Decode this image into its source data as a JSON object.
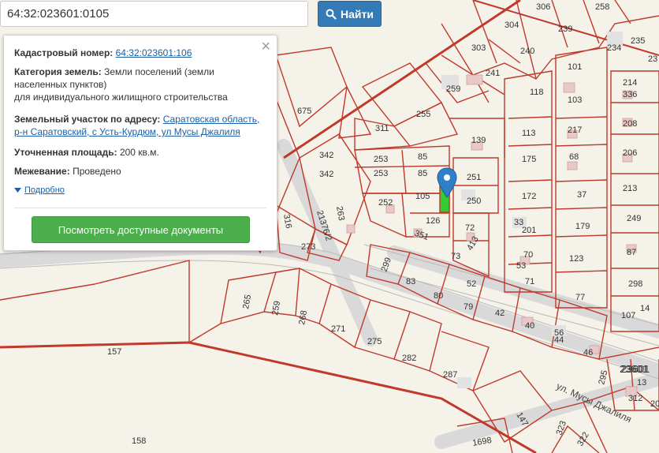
{
  "search": {
    "value": "64:32:023601:0105",
    "button_label": "Найти",
    "icon": "search-icon"
  },
  "info_panel": {
    "cadastral_label": "Кадастровый номер:",
    "cadastral_number": "64:32:023601:106",
    "category_label": "Категория земель:",
    "category_value_1": "Земли поселений (земли",
    "category_value_2": "населенных пунктов)",
    "category_value_3": "для индивидуального жилищного строительства",
    "address_label": "Земельный участок по адресу:",
    "address_value_1": "Саратовская область,",
    "address_value_2": "р-н Саратовский, с Усть-Курдюм, ул Мусы Джалиля",
    "area_label": "Уточненная площадь:",
    "area_value": "200 кв.м.",
    "survey_label": "Межевание:",
    "survey_value": "Проведено",
    "more_label": "Подробно",
    "docs_button": "Посмотреть доступные документы",
    "close_icon": "close-icon"
  },
  "map": {
    "street_label": "ул. Мусы Джалиля",
    "quarter_label": "23601",
    "parcel_labels": [
      "306",
      "258",
      "304",
      "239",
      "303",
      "240",
      "234",
      "235",
      "23",
      "241",
      "101",
      "259",
      "214",
      "675",
      "118",
      "103",
      "336",
      "255",
      "311",
      "217",
      "208",
      "113",
      "139",
      "342",
      "85",
      "253",
      "206",
      "175",
      "68",
      "342",
      "85",
      "253",
      "251",
      "213",
      "105",
      "316",
      "252",
      "250",
      "172",
      "37",
      "263",
      "126",
      "33",
      "201",
      "179",
      "249",
      "21376/2",
      "72",
      "351",
      "273",
      "73",
      "413",
      "70",
      "123",
      "87",
      "299",
      "53",
      "83",
      "80",
      "52",
      "71",
      "298",
      "79",
      "77",
      "14",
      "265",
      "259",
      "268",
      "42",
      "107",
      "271",
      "40",
      "56",
      "44",
      "275",
      "157",
      "282",
      "46",
      "287",
      "23601",
      "295",
      "13",
      "312",
      "20",
      "147",
      "158",
      "1698",
      "323",
      "322"
    ],
    "colors": {
      "boundary": "#c0392b",
      "road": "#d8d8d8",
      "selected_parcel": "#33cc33",
      "pin": "#2f80c8"
    }
  }
}
